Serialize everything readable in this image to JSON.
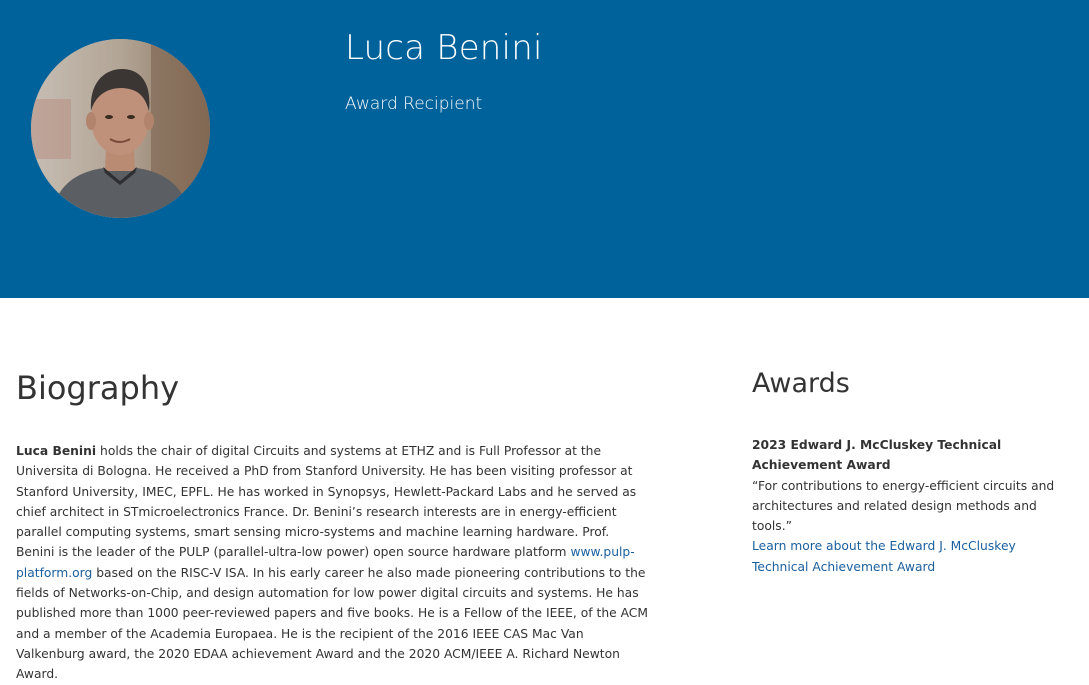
{
  "header": {
    "name": "Luca Benini",
    "role": "Award Recipient",
    "background_color": "#00629b",
    "avatar": "portrait-photo"
  },
  "biography": {
    "heading": "Biography",
    "name_bold": "Luca Benini",
    "text_part1": " holds the chair of digital Circuits and systems at ETHZ and is Full Professor at the Universita di Bologna. He received a PhD from Stanford University. He has been visiting professor at Stanford University, IMEC, EPFL. He has worked in Synopsys, Hewlett-Packard Labs and he served as chief architect in STmicroelectronics France. Dr. Benini’s research interests are in energy-efficient parallel computing systems, smart sensing micro-systems and machine learning hardware.  Prof. Benini is the leader of the PULP (parallel-ultra-low power) open source hardware platform ",
    "link_text": "www.pulp-platform.org",
    "text_part2": "  based on the RISC-V ISA. In his early career he also made pioneering contributions to the fields of Networks-on-Chip, and design automation for low power digital circuits and systems.  He has published more than 1000 peer-reviewed papers and five books.  He is a Fellow of the IEEE, of the ACM and a member of the Academia Europaea. He is the recipient of the 2016 IEEE CAS Mac Van Valkenburg award, the 2020 EDAA achievement Award and the 2020 ACM/IEEE A. Richard Newton Award."
  },
  "awards": {
    "heading": "Awards",
    "items": [
      {
        "title": "2023 Edward J. McCluskey Technical Achievement Award",
        "citation": "“For contributions to energy-efficient circuits and architectures and related design methods and tools.”",
        "link_text": "Learn more about the Edward J. McCluskey Technical Achievement Award"
      }
    ]
  },
  "colors": {
    "link": "#1a5f9e",
    "text": "#333333"
  }
}
